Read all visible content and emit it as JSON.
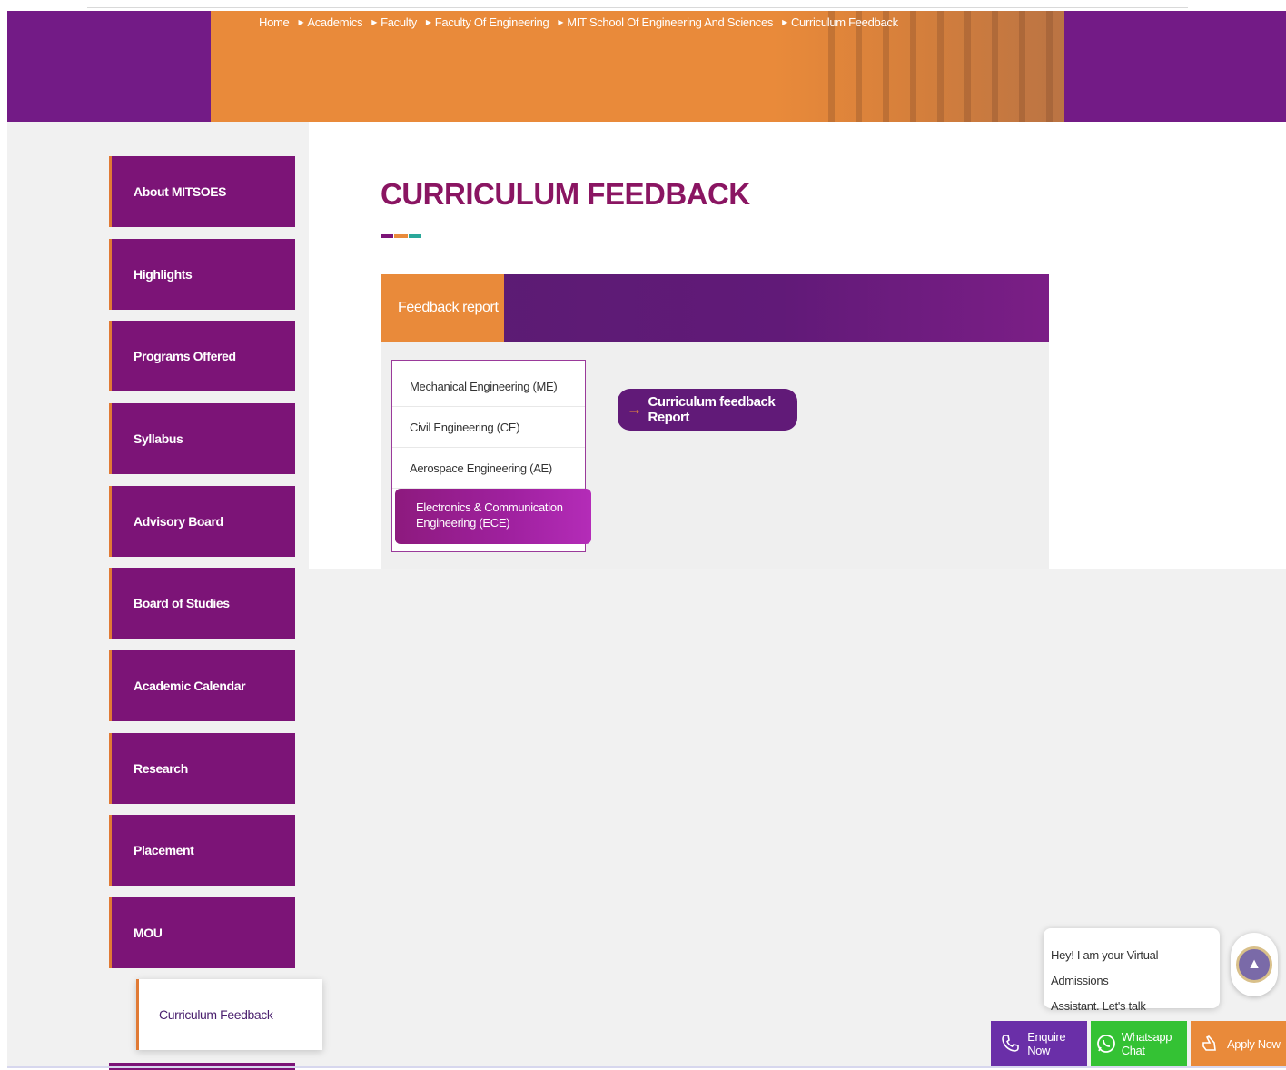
{
  "breadcrumb": [
    "Home",
    "Academics",
    "Faculty",
    "Faculty Of Engineering",
    "MIT School Of Engineering And Sciences",
    "Curriculum Feedback"
  ],
  "sidebar": {
    "items": [
      "About MITSOES",
      "Highlights",
      "Programs Offered",
      "Syllabus",
      "Advisory Board",
      "Board of Studies",
      "Academic Calendar",
      "Research",
      "Placement",
      "MOU"
    ],
    "active_subitem": "Curriculum Feedback"
  },
  "page": {
    "title": "CURRICULUM FEEDBACK",
    "accent_colors": [
      "#7c1477",
      "#e98a3a",
      "#2aa89a"
    ]
  },
  "panel": {
    "tab_label": "Feedback report",
    "departments": [
      "Mechanical Engineering (ME)",
      "Civil Engineering (CE)",
      "Aerospace Engineering (AE)"
    ],
    "active_department": {
      "line1": "Electronics & Communication",
      "line2": "Engineering (ECE)"
    },
    "report_button": "Curriculum feedback Report"
  },
  "chat": {
    "line1": "Hey! I am your Virtual Admissions",
    "line2": "Assistant. Let's talk"
  },
  "cta": {
    "enquire": "Enquire Now",
    "whatsapp": "Whatsapp Chat",
    "apply": "Apply Now"
  },
  "icons": {
    "breadcrumb_separator": "triangle-right-icon",
    "enquire": "phone-icon",
    "whatsapp": "whatsapp-icon",
    "apply": "pointing-hand-icon",
    "report_button": "arrow-right-icon"
  },
  "colors": {
    "brand_purple": "#731b86",
    "brand_orange": "#e98a3a",
    "title": "#8a1562",
    "whatsapp_green": "#34c234"
  }
}
